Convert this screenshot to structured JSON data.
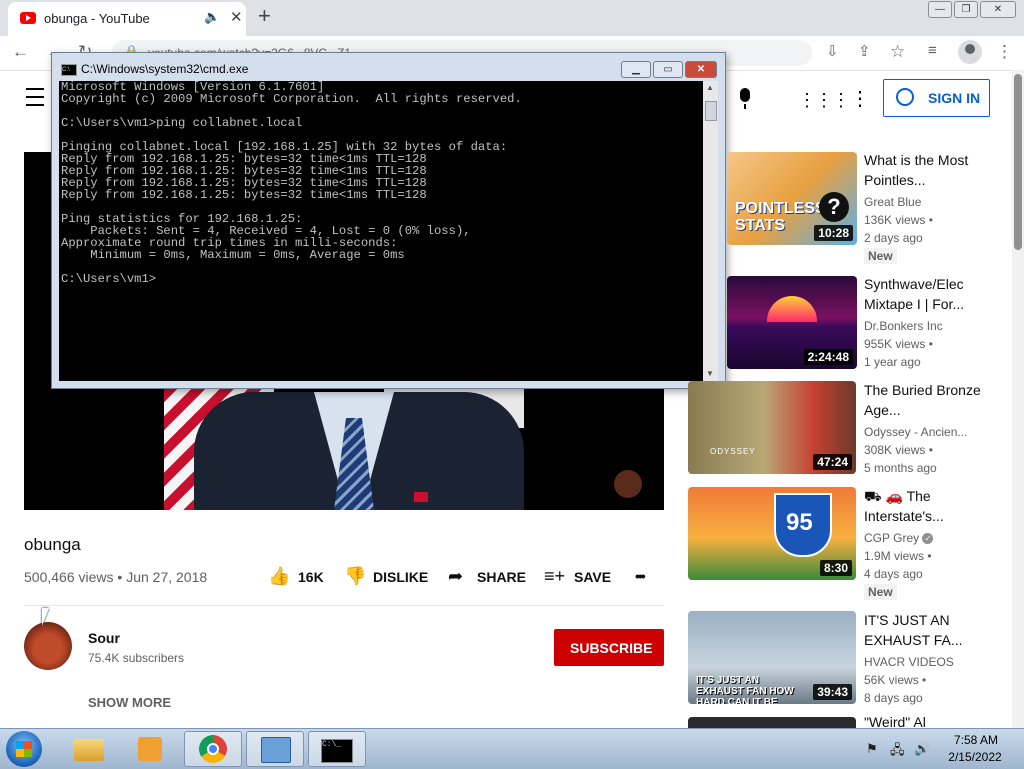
{
  "browser": {
    "tab_title": "obunga - YouTube",
    "tab_close": "✕",
    "new_tab": "+",
    "url": "youtube.com/watch?v=2G6...8VC...Z1...",
    "window_buttons": [
      "—",
      "❐",
      "✕"
    ]
  },
  "youtube": {
    "signin_label": "SIGN IN",
    "video": {
      "title": "obunga",
      "views": "500,466 views",
      "date": "Jun 27, 2018",
      "likes": "16K",
      "dislike_label": "DISLIKE",
      "share_label": "SHARE",
      "save_label": "SAVE",
      "more": "•••"
    },
    "channel": {
      "name": "Sour",
      "subscribers": "75.4K subscribers",
      "subscribe_label": "SUBSCRIBE",
      "show_more": "SHOW MORE"
    },
    "sidebar": [
      {
        "title": "What is the Most Pointles...",
        "channel": "Great Blue",
        "views": "136K views •",
        "age": "2 days ago",
        "badge": "New",
        "duration": "10:28",
        "thumb_text": "POINTLESS STATS"
      },
      {
        "title": "Synthwave/Elec Mixtape I | For...",
        "channel": "Dr.Bonkers Inc",
        "views": "955K views •",
        "age": "1 year ago",
        "badge": "",
        "duration": "2:24:48",
        "thumb_text": ""
      },
      {
        "title": "The Buried Bronze Age...",
        "channel": "Odyssey - Ancien...",
        "views": "308K views •",
        "age": "5 months ago",
        "badge": "",
        "duration": "47:24",
        "thumb_text": "ODYSSEY"
      },
      {
        "title": "⛟ 🚗 The Interstate's...",
        "channel": "CGP Grey",
        "views": "1.9M views •",
        "age": "4 days ago",
        "badge": "New",
        "duration": "8:30",
        "thumb_text": "95"
      },
      {
        "title": "IT'S JUST AN EXHAUST FA...",
        "channel": "HVACR VIDEOS",
        "views": "56K views •",
        "age": "8 days ago",
        "badge": "",
        "duration": "39:43",
        "thumb_text": "IT'S JUST AN EXHAUST FAN HOW HARD CAN IT BE"
      },
      {
        "title": "\"Weird\" Al",
        "channel": "",
        "views": "",
        "age": "",
        "badge": "",
        "duration": "",
        "thumb_text": ""
      }
    ]
  },
  "cmd": {
    "title": "C:\\Windows\\system32\\cmd.exe",
    "output": "Microsoft Windows [Version 6.1.7601]\nCopyright (c) 2009 Microsoft Corporation.  All rights reserved.\n\nC:\\Users\\vm1>ping collabnet.local\n\nPinging collabnet.local [192.168.1.25] with 32 bytes of data:\nReply from 192.168.1.25: bytes=32 time<1ms TTL=128\nReply from 192.168.1.25: bytes=32 time<1ms TTL=128\nReply from 192.168.1.25: bytes=32 time<1ms TTL=128\nReply from 192.168.1.25: bytes=32 time<1ms TTL=128\n\nPing statistics for 192.168.1.25:\n    Packets: Sent = 4, Received = 4, Lost = 0 (0% loss),\nApproximate round trip times in milli-seconds:\n    Minimum = 0ms, Maximum = 0ms, Average = 0ms\n\nC:\\Users\\vm1>"
  },
  "taskbar": {
    "time": "7:58 AM",
    "date": "2/15/2022"
  }
}
